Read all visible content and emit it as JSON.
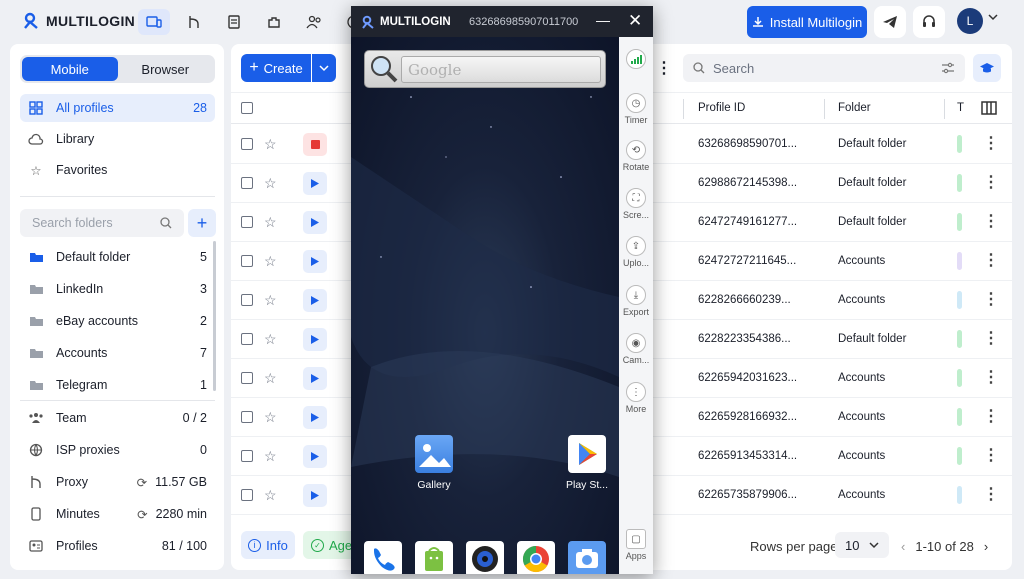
{
  "app": {
    "logo_text": "MULTILOGIN",
    "install_label": "Install Multilogin",
    "avatar_letter": "L"
  },
  "colors": {
    "accent": "#1a5ee8",
    "accent_light": "#e7eefc",
    "danger": "#e53935",
    "agent_green": "#21a94b"
  },
  "sidebar": {
    "tabs": [
      {
        "label": "Mobile",
        "active": true
      },
      {
        "label": "Browser",
        "active": false
      }
    ],
    "nav": [
      {
        "label": "All profiles",
        "count": "28",
        "icon": "grid-icon"
      },
      {
        "label": "Library",
        "count": "",
        "icon": "cloud-icon"
      },
      {
        "label": "Favorites",
        "count": "",
        "icon": "star-icon"
      }
    ],
    "search_placeholder": "Search folders",
    "folders": [
      {
        "label": "Default folder",
        "count": "5"
      },
      {
        "label": "LinkedIn",
        "count": "3"
      },
      {
        "label": "eBay accounts",
        "count": "2"
      },
      {
        "label": "Accounts",
        "count": "7"
      },
      {
        "label": "Telegram",
        "count": "1"
      }
    ],
    "stats": [
      {
        "label": "Team",
        "value": "0 / 2",
        "icon": "team-icon"
      },
      {
        "label": "ISP proxies",
        "value": "0",
        "icon": "globe-icon"
      },
      {
        "label": "Proxy",
        "value": "11.57 GB",
        "icon": "proxy-icon"
      },
      {
        "label": "Minutes",
        "value": "2280 min",
        "icon": "phone-icon"
      },
      {
        "label": "Profiles",
        "value": "81 / 100",
        "icon": "profiles-icon"
      }
    ]
  },
  "main": {
    "create_label": "Create",
    "search_placeholder": "Search",
    "columns": {
      "profile_id": "Profile ID",
      "folder": "Folder",
      "tags": "T"
    },
    "rows": [
      {
        "profile_id": "63268698590701...",
        "folder": "Default folder",
        "status": "stop",
        "tag_color": "#bfeecd"
      },
      {
        "profile_id": "62988672145398...",
        "folder": "Default folder",
        "status": "play",
        "tag_color": "#bfeecd"
      },
      {
        "profile_id": "62472749161277...",
        "folder": "Default folder",
        "status": "play",
        "tag_color": "#bfeecd"
      },
      {
        "profile_id": "62472727211645...",
        "folder": "Accounts",
        "status": "play",
        "tag_color": "#e3dcf7"
      },
      {
        "profile_id": "6228266660239...",
        "folder": "Accounts",
        "status": "play",
        "tag_color": "#cfe9f7"
      },
      {
        "profile_id": "6228223354386...",
        "folder": "Default folder",
        "status": "play",
        "tag_color": "#bfeecd"
      },
      {
        "profile_id": "62265942031623...",
        "folder": "Accounts",
        "status": "play",
        "tag_color": "#bfeecd"
      },
      {
        "profile_id": "62265928166932...",
        "folder": "Accounts",
        "status": "play",
        "tag_color": "#bfeecd"
      },
      {
        "profile_id": "62265913453314...",
        "folder": "Accounts",
        "status": "play",
        "tag_color": "#bfeecd"
      },
      {
        "profile_id": "62265735879906...",
        "folder": "Accounts",
        "status": "play",
        "tag_color": "#cfe9f7"
      }
    ],
    "footer": {
      "info_label": "Info",
      "agent_label": "Agen",
      "rows_per_page_label": "Rows per page",
      "rows_per_page_value": "10",
      "range": "1-10 of 28"
    }
  },
  "phone": {
    "title": "MULTILOGIN",
    "profile_id": "632686985907011700",
    "search_placeholder": "Google",
    "apps": [
      {
        "label": "Gallery"
      },
      {
        "label": "Play St..."
      }
    ],
    "side": [
      {
        "label": "",
        "icon": "signal-icon"
      },
      {
        "label": "Timer",
        "icon": "clock-icon"
      },
      {
        "label": "Rotate",
        "icon": "rotate-icon"
      },
      {
        "label": "Scre...",
        "icon": "screenshot-icon"
      },
      {
        "label": "Uplo...",
        "icon": "upload-icon"
      },
      {
        "label": "Export",
        "icon": "download-icon"
      },
      {
        "label": "Cam...",
        "icon": "camera-icon"
      },
      {
        "label": "More",
        "icon": "more-icon"
      },
      {
        "label": "Apps",
        "icon": "apps-icon"
      }
    ]
  }
}
